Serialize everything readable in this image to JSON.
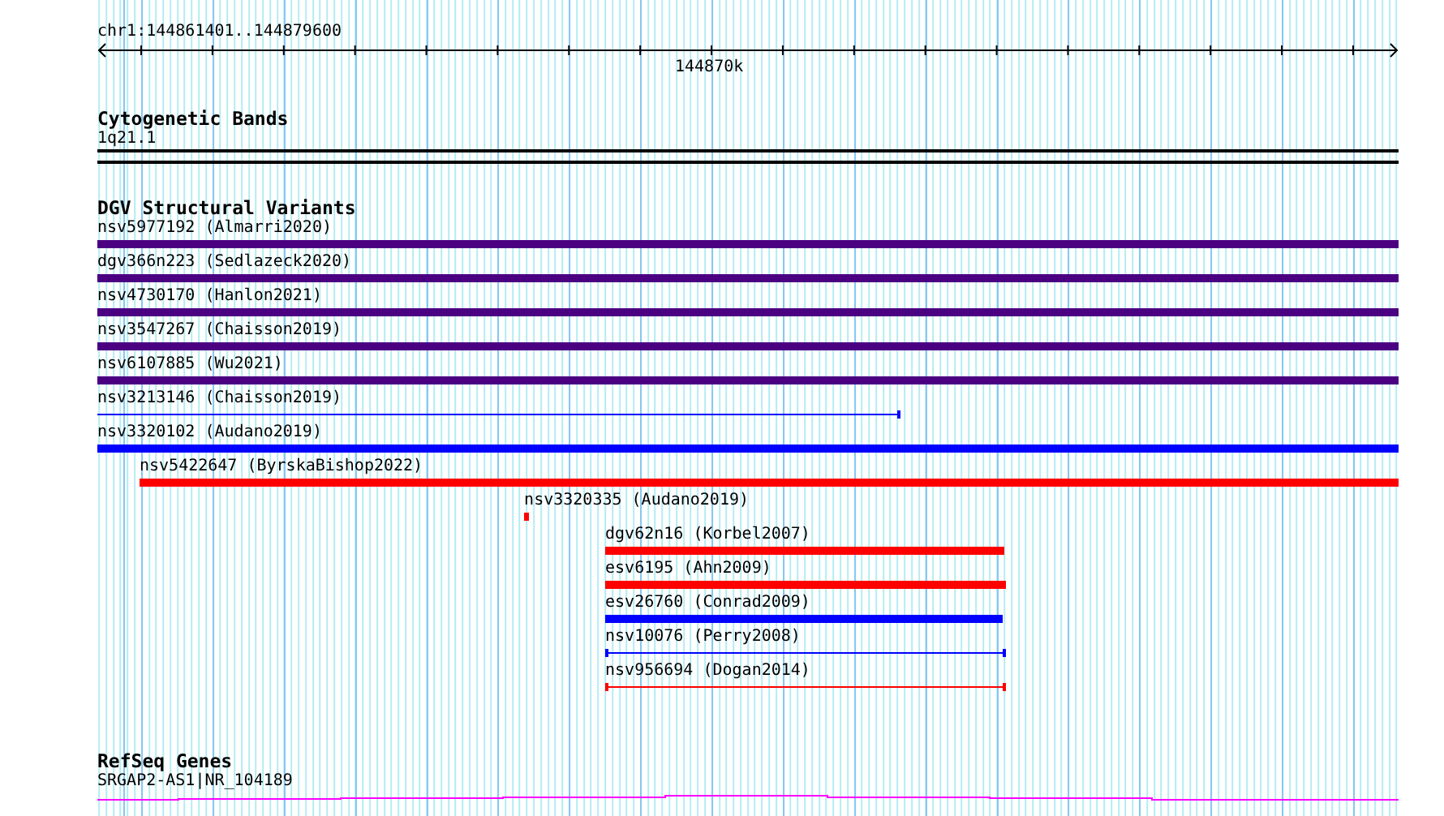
{
  "ruler": {
    "region": "chr1:144861401..144879600",
    "tick_label": "144870k"
  },
  "cytogenetic_bands": {
    "title": "Cytogenetic Bands",
    "band": "1q21.1"
  },
  "dgv_structural_variants": {
    "title": "DGV Structural Variants",
    "items": [
      {
        "label": "nsv5977192 (Almarri2020)",
        "kind": "bar",
        "color": "#4b0082"
      },
      {
        "label": "dgv366n223 (Sedlazeck2020)",
        "kind": "bar",
        "color": "#4b0082"
      },
      {
        "label": "nsv4730170 (Hanlon2021)",
        "kind": "bar",
        "color": "#4b0082"
      },
      {
        "label": "nsv3547267 (Chaisson2019)",
        "kind": "bar",
        "color": "#4b0082"
      },
      {
        "label": "nsv6107885 (Wu2021)",
        "kind": "bar",
        "color": "#4b0082"
      },
      {
        "label": "nsv3213146 (Chaisson2019)",
        "kind": "line",
        "color": "#0000ff"
      },
      {
        "label": "nsv3320102 (Audano2019)",
        "kind": "bar",
        "color": "#0000ff"
      },
      {
        "label": "nsv5422647 (ByrskaBishop2022)",
        "kind": "bar",
        "color": "#ff0000"
      },
      {
        "label": "nsv3320335 (Audano2019)",
        "kind": "bar",
        "color": "#ff0000"
      },
      {
        "label": "dgv62n16 (Korbel2007)",
        "kind": "bar",
        "color": "#ff0000"
      },
      {
        "label": "esv6195 (Ahn2009)",
        "kind": "bar",
        "color": "#ff0000"
      },
      {
        "label": "esv26760 (Conrad2009)",
        "kind": "bar",
        "color": "#0000ff"
      },
      {
        "label": "nsv10076 (Perry2008)",
        "kind": "line",
        "color": "#0000ff"
      },
      {
        "label": "nsv956694 (Dogan2014)",
        "kind": "line",
        "color": "#ff0000"
      }
    ]
  },
  "refseq_genes": {
    "title": "RefSeq Genes",
    "gene": "SRGAP2-AS1|NR_104189"
  }
}
